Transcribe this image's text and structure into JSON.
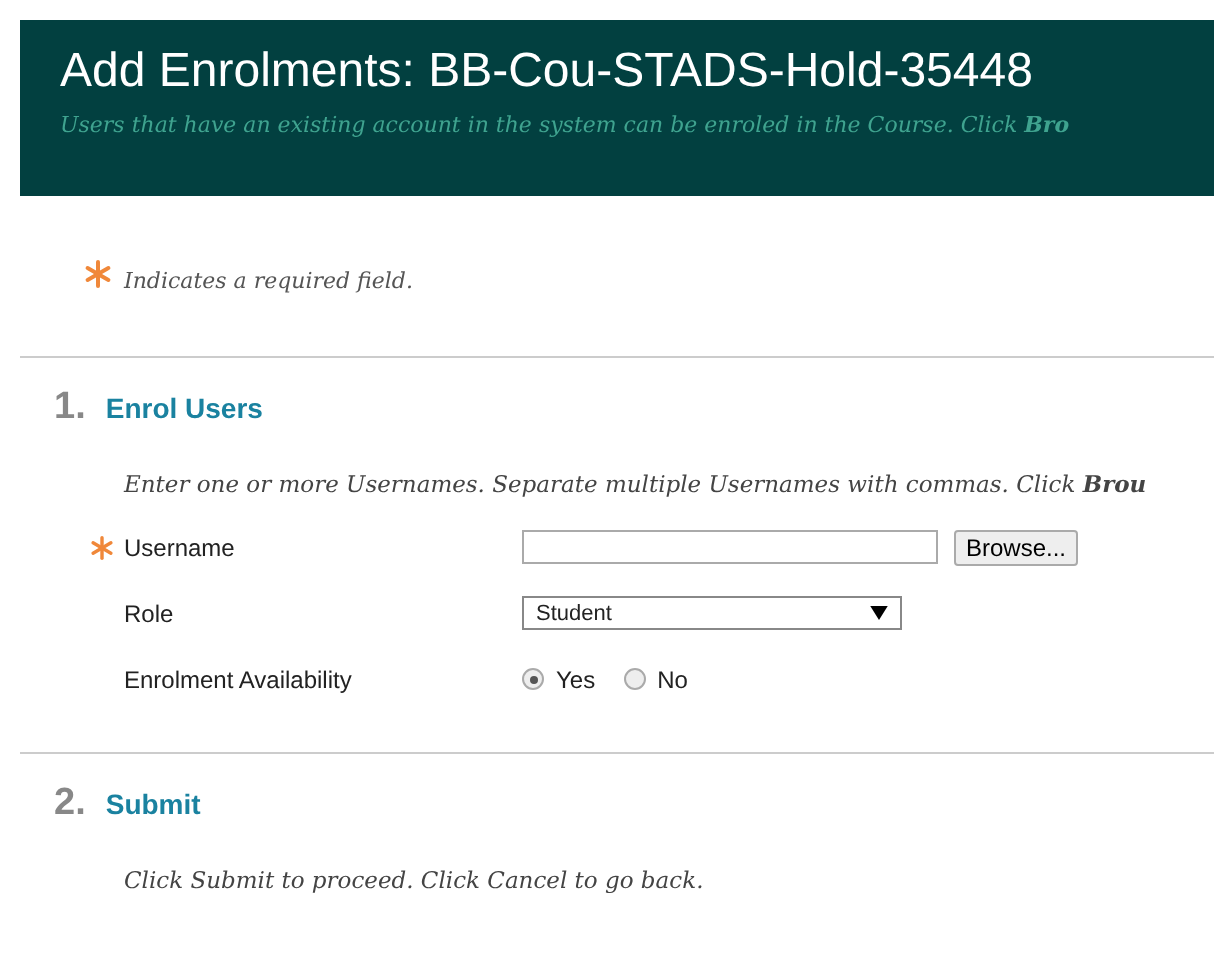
{
  "header": {
    "title": "Add Enrolments: BB-Cou-STADS-Hold-35448",
    "description": "Users that have an existing account in the system can be enroled in the Course. Click **Bro**"
  },
  "required_note": "Indicates a required field.",
  "sections": [
    {
      "number": "1.",
      "title": "Enrol Users",
      "instructions": "Enter one or more Usernames. Separate multiple Usernames with commas. Click **Brou**",
      "fields": [
        {
          "kind": "text",
          "label": "Username",
          "required": true,
          "button": "Browse..."
        },
        {
          "kind": "select",
          "label": "Role",
          "required": false,
          "value": "Student"
        },
        {
          "kind": "radio",
          "label": "Enrolment Availability",
          "required": false,
          "options": [
            {
              "label": "Yes",
              "selected": true
            },
            {
              "label": "No",
              "selected": false
            }
          ]
        }
      ]
    },
    {
      "number": "2.",
      "title": "Submit",
      "instructions": "Click Submit to proceed. Click Cancel to go back."
    }
  ]
}
